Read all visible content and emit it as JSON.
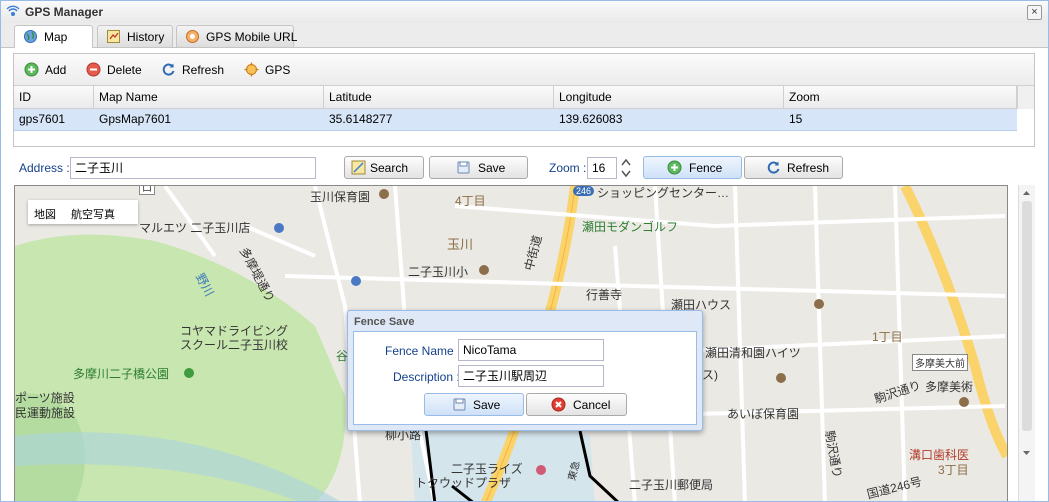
{
  "window": {
    "title": "GPS Manager",
    "close_glyph": "×"
  },
  "tabs": [
    {
      "label": "Map",
      "icon": "globe-icon",
      "active": true
    },
    {
      "label": "History",
      "icon": "history-icon",
      "active": false
    },
    {
      "label": "GPS Mobile URL",
      "icon": "mobile-url-icon",
      "active": false
    }
  ],
  "toolbar": {
    "add": "Add",
    "delete": "Delete",
    "refresh": "Refresh",
    "gps": "GPS"
  },
  "grid": {
    "columns": [
      "ID",
      "Map Name",
      "Latitude",
      "Longitude",
      "Zoom"
    ],
    "rows": [
      {
        "id": "gps7601",
        "map_name": "GpsMap7601",
        "latitude": "35.6148277",
        "longitude": "139.626083",
        "zoom": "15"
      }
    ]
  },
  "form": {
    "address_label": "Address :",
    "address_value": "二子玉川",
    "search": "Search",
    "save": "Save",
    "zoom_label": "Zoom :",
    "zoom_value": "16",
    "fence": "Fence",
    "refresh": "Refresh"
  },
  "map": {
    "type_map": "地図",
    "type_satellite": "航空写真",
    "labels": {
      "l1": "玉川保育園",
      "l2": "4丁目",
      "l3": "ショッピングセンター…",
      "l4": "マルエツ 二子玉川店",
      "l5": "瀬田モダンゴルフ",
      "l6": "玉川",
      "l7": "二子玉川小",
      "l8": "多摩堤通り",
      "l9": "野川",
      "l10": "行善寺",
      "l11": "瀬田ハウス",
      "l12": "コヤマドライビング",
      "l13": "スクール二子玉川校",
      "l14": "1丁目",
      "l15": "多摩川二子橋公園",
      "l16": "瀬田清和園ハイツ",
      "l17": "多摩美大前",
      "l18": "ポーツ施設",
      "l19": "民運動施設",
      "l20": "駒沢通り",
      "l21": "多摩美術",
      "l22": "あいぼ保育園",
      "l23": "柳小路",
      "l24": "二子玉ライズ",
      "l25": "トクウッドプラザ",
      "l26": "二子玉川郵便局",
      "l27": "溝口歯科医",
      "l28": "3丁目",
      "l29": "駒沢通り",
      "l30": "国道246号",
      "l31": "谷",
      "l32": "中街道",
      "l33": "東急",
      "l34": "(ス)",
      "l35": "246",
      "l36": "口"
    }
  },
  "dialog": {
    "title": "Fence Save",
    "name_label": "Fence Name :",
    "name_value": "NicoTama",
    "desc_label": "Description :",
    "desc_value": "二子玉川駅周辺",
    "save": "Save",
    "cancel": "Cancel"
  },
  "colors": {
    "accent": "#15428b",
    "selected_row": "#d6e5f7",
    "park": "#c8e6b0",
    "water": "#aad3df",
    "fence": "#000000"
  }
}
